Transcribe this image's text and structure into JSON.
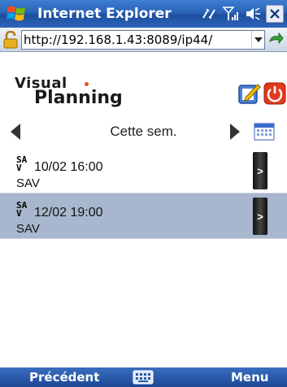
{
  "titlebar": {
    "title": "Internet Explorer",
    "icons": [
      "windows-start-icon",
      "connectivity-icon",
      "signal-icon",
      "speaker-icon",
      "close-icon"
    ]
  },
  "addressbar": {
    "url": "http://192.168.1.43:8089/ip44/"
  },
  "app": {
    "logo_line1": "Visual",
    "logo_line2": "Planning"
  },
  "nav": {
    "week_label": "Cette sem."
  },
  "items": [
    {
      "badge_top": "SA",
      "badge_bottom": "V",
      "datetime": "10/02 16:00",
      "category": "SAV",
      "selected": false
    },
    {
      "badge_top": "SA",
      "badge_bottom": "V",
      "datetime": "12/02 19:00",
      "category": "SAV",
      "selected": true
    }
  ],
  "softkeys": {
    "left": "Précédent",
    "right": "Menu"
  },
  "colors": {
    "titlebar": "#2a63b8",
    "selected_row": "#a8b7ce",
    "power_button": "#e03a1e"
  }
}
